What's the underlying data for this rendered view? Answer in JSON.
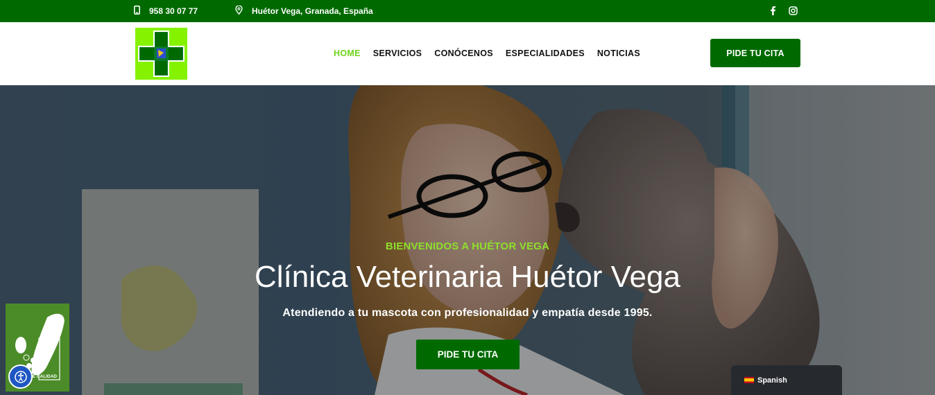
{
  "topbar": {
    "phone": "958 30 07 77",
    "address": "Huétor Vega, Granada, España",
    "phone_icon": "mobile-phone-icon",
    "address_icon": "map-pin-icon",
    "facebook_icon": "facebook-icon",
    "instagram_icon": "instagram-icon"
  },
  "header": {
    "nav": [
      "HOME",
      "SERVICIOS",
      "CONÓCENOS",
      "ESPECIALIDADES",
      "NOTICIAS"
    ],
    "active_index": 0,
    "cta": "PIDE TU CITA"
  },
  "hero": {
    "eyebrow": "BIENVENIDOS A HUÉTOR VEGA",
    "title": "Clínica Veterinaria Huétor Vega",
    "subtitle": "Atendiendo a tu mascota con profesionalidad y empatía desde 1995.",
    "cta": "PIDE TU CITA"
  },
  "badge": {
    "text": "DE CALIDAD"
  },
  "accessibility_icon": "accessibility-icon",
  "language": {
    "label": "Spanish"
  },
  "colors": {
    "brand_green": "#006a00",
    "accent_green": "#8ee02b",
    "logo_green": "#85f200"
  }
}
